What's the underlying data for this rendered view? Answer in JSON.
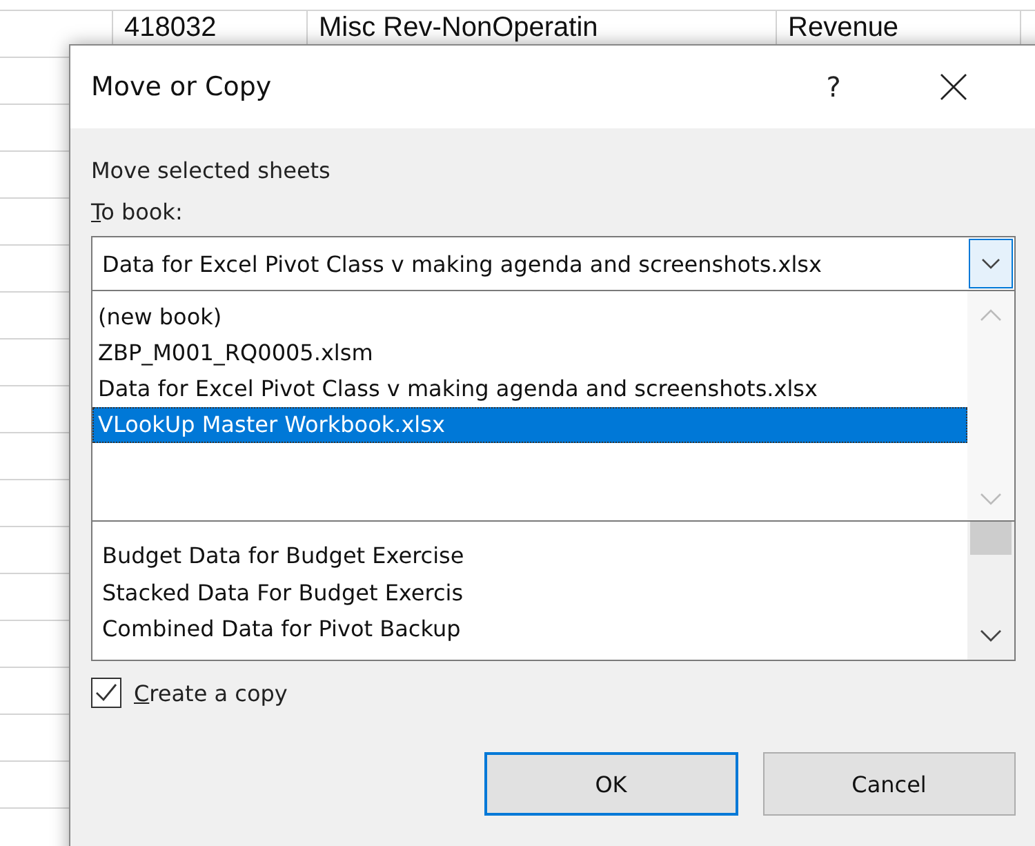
{
  "spreadsheet": {
    "cells": [
      "418032",
      "Misc Rev-NonOperatin",
      "Revenue"
    ]
  },
  "dialog": {
    "title": "Move or Copy",
    "help": "?",
    "section_label": "Move selected sheets",
    "to_book_label": "To book:",
    "to_book_value": "Data for Excel Pivot Class v making agenda and screenshots.xlsx",
    "book_options": [
      {
        "label": "(new book)",
        "selected": false
      },
      {
        "label": "ZBP_M001_RQ0005.xlsm",
        "selected": false
      },
      {
        "label": "Data for Excel Pivot Class v making agenda and screenshots.xlsx",
        "selected": false
      },
      {
        "label": "VLookUp Master Workbook.xlsx",
        "selected": true
      }
    ],
    "sheets": [
      "Budget Data for Budget Exercise",
      "Stacked Data For Budget Exercis",
      "Combined Data for Pivot Backup"
    ],
    "create_copy": {
      "label": "Create a copy",
      "checked": true
    },
    "buttons": [
      {
        "label": "OK",
        "default": true
      },
      {
        "label": "Cancel",
        "default": false
      }
    ]
  }
}
